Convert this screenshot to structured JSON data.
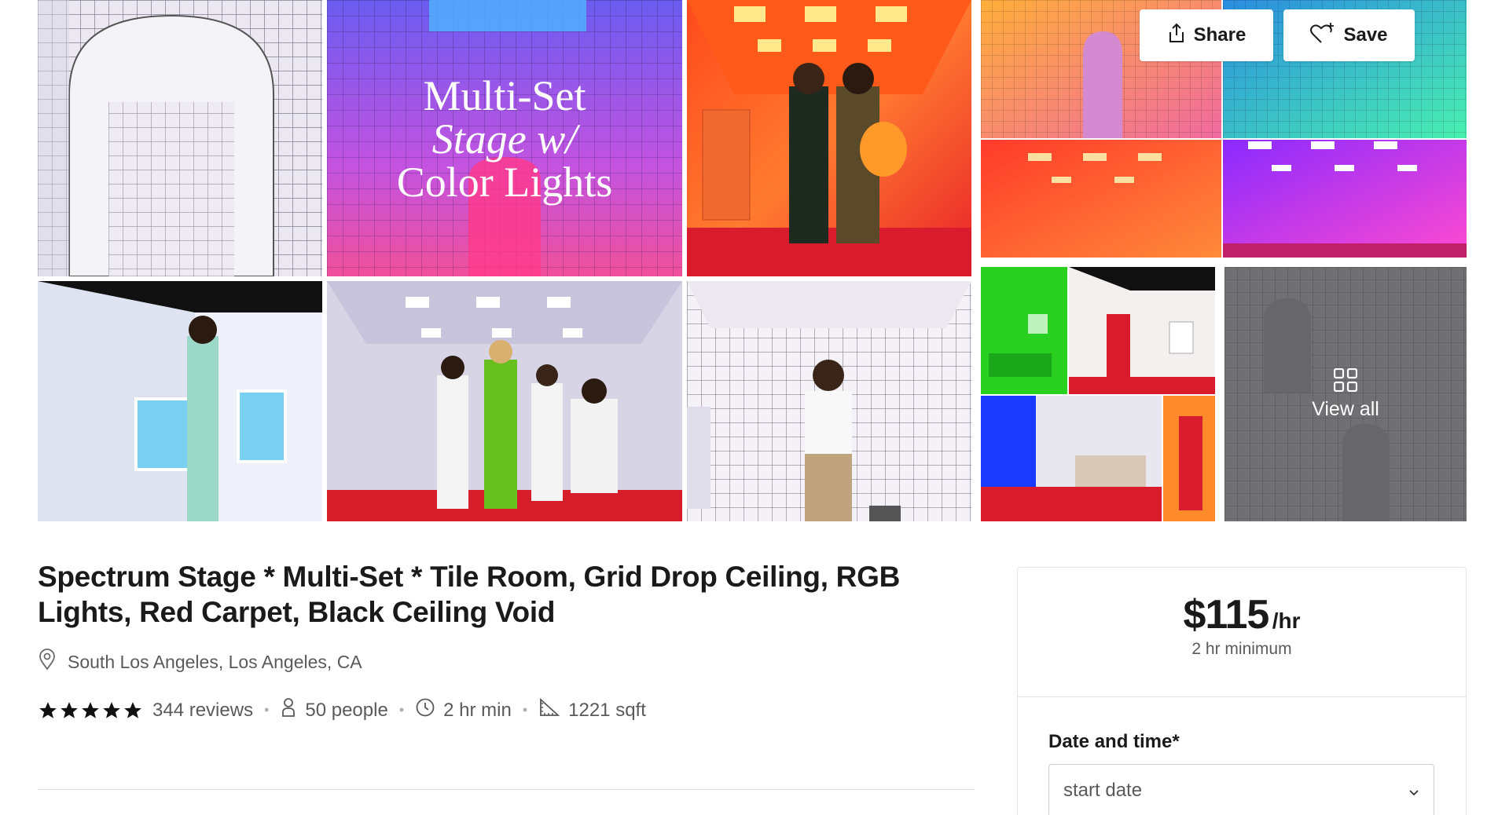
{
  "gallery": {
    "share_label": "Share",
    "save_label": "Save",
    "view_all_label": "View all",
    "overlay_text": [
      "Multi-Set",
      "Stage w/",
      "Color Lights"
    ]
  },
  "listing": {
    "title": "Spectrum Stage * Multi-Set * Tile Room, Grid Drop Ceiling, RGB Lights, Red Carpet, Black Ceiling Void",
    "location": "South Los Angeles, Los Angeles, CA",
    "rating_stars": 5,
    "reviews": "344 reviews",
    "capacity": "50 people",
    "min_hours": "2 hr min",
    "size": "1221 sqft"
  },
  "booking": {
    "price": "$115",
    "per": "/hr",
    "minimum": "2 hr minimum",
    "date_label": "Date and time*",
    "date_placeholder": "start date"
  }
}
